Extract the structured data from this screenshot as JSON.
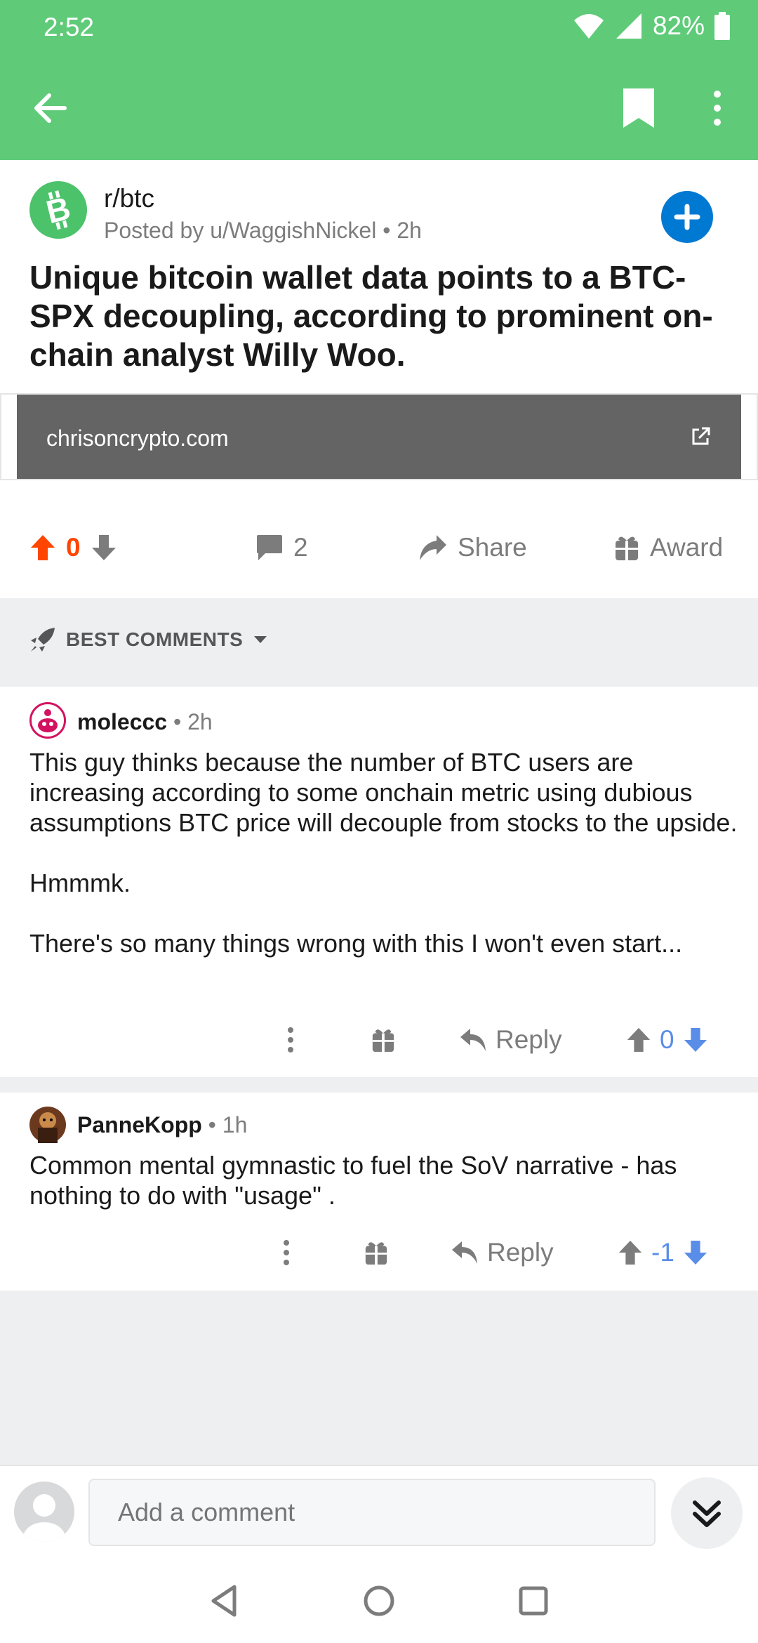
{
  "status": {
    "time": "2:52",
    "battery": "82%"
  },
  "toolbar": {
    "back_icon": "arrow-left-icon",
    "bookmark_icon": "bookmark-icon",
    "more_icon": "more-vert-icon"
  },
  "post": {
    "subreddit": "r/btc",
    "posted_by": "Posted by u/WaggishNickel",
    "age": "2h",
    "title": "Unique bitcoin wallet data points to a BTC-SPX decoupling, according to prominent on-chain analyst Willy Woo.",
    "link_domain": "chrisoncrypto.com",
    "score": "0",
    "comment_count": "2",
    "share_label": "Share",
    "award_label": "Award"
  },
  "sort": {
    "label": "BEST COMMENTS"
  },
  "comments": [
    {
      "author": "moleccc",
      "age": "2h",
      "paragraphs": [
        "This guy thinks because the number of BTC users are increasing according to some onchain metric using dubious assumptions BTC price will decouple from stocks to the upside.",
        "Hmmmk.",
        "There's so many things wrong with this I won't even start..."
      ],
      "reply_label": "Reply",
      "score": "0"
    },
    {
      "author": "PanneKopp",
      "age": "1h",
      "paragraphs": [
        "Common mental gymnastic to fuel the SoV narrative - has nothing to do with \"usage\" ."
      ],
      "reply_label": "Reply",
      "score": "-1"
    }
  ],
  "comment_bar": {
    "placeholder": "Add a comment"
  },
  "colors": {
    "header_green": "#5fcb79",
    "upvote_orange": "#ff4500",
    "vote_blue": "#5a8de8",
    "join_blue": "#0079d3"
  }
}
